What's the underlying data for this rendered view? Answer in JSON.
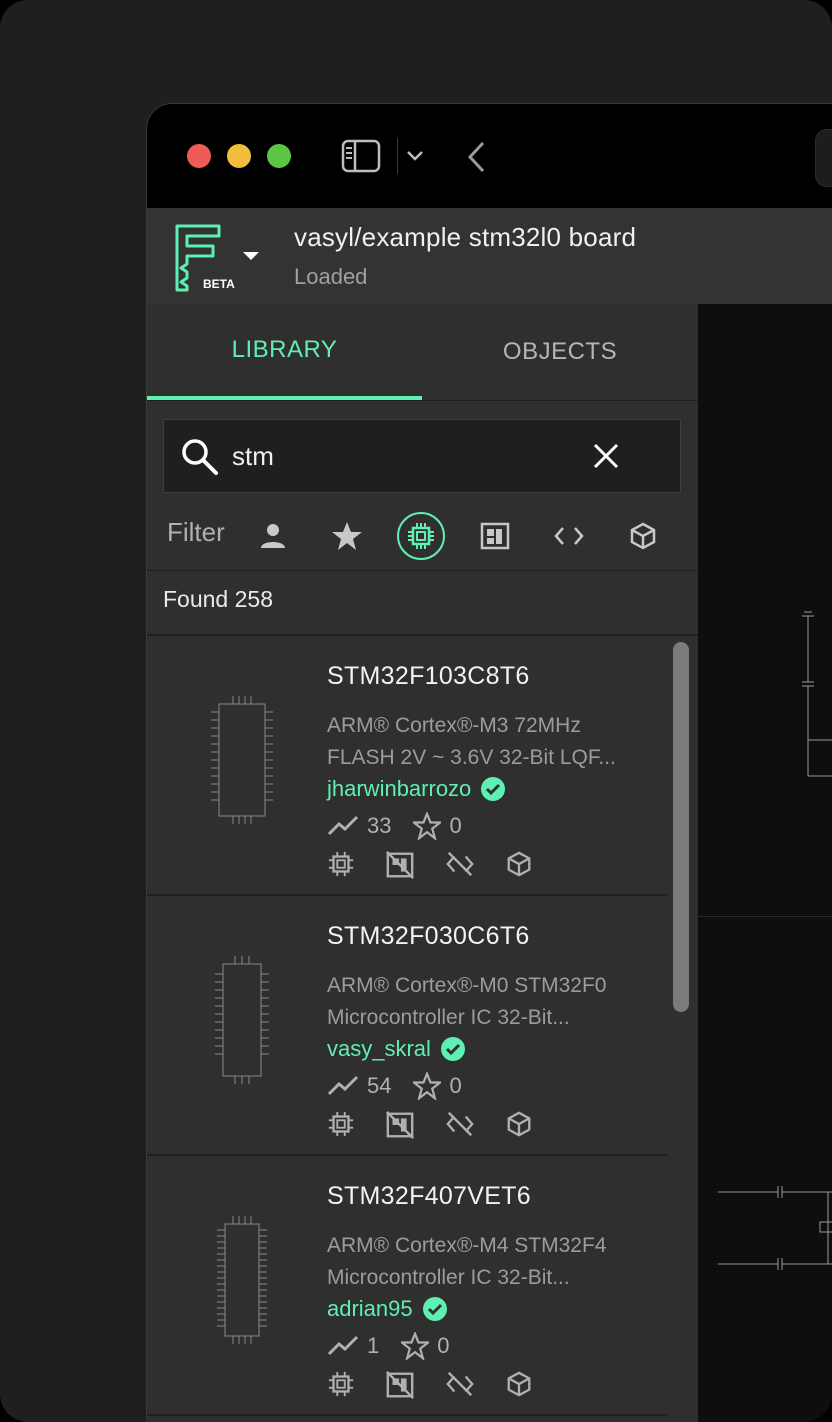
{
  "project": {
    "title": "vasyl/example stm32l0 board",
    "status": "Loaded",
    "logo_badge": "BETA"
  },
  "tabs": [
    {
      "label": "LIBRARY"
    },
    {
      "label": "OBJECTS"
    }
  ],
  "search": {
    "value": "stm"
  },
  "filter": {
    "label": "Filter",
    "icons": [
      "person-icon",
      "star-icon",
      "chip-icon",
      "footprint-icon",
      "code-icon",
      "cube-icon"
    ],
    "active": "chip-icon"
  },
  "results": {
    "found_label": "Found 258",
    "items": [
      {
        "title": "STM32F103C8T6",
        "desc_line1": "ARM® Cortex®-M3 72MHz",
        "desc_line2": "FLASH 2V ~ 3.6V 32-Bit LQF...",
        "author": "jharwinbarrozo",
        "usage": "33",
        "stars": "0"
      },
      {
        "title": "STM32F030C6T6",
        "desc_line1": "ARM® Cortex®-M0 STM32F0",
        "desc_line2": "Microcontroller IC 32-Bit...",
        "author": "vasy_skral",
        "usage": "54",
        "stars": "0"
      },
      {
        "title": "STM32F407VET6",
        "desc_line1": "ARM® Cortex®-M4 STM32F4",
        "desc_line2": "Microcontroller IC 32-Bit...",
        "author": "adrian95",
        "usage": "1",
        "stars": "0"
      }
    ]
  },
  "colors": {
    "accent": "#5ef0b2",
    "panel": "#2f2f2f",
    "header": "#333333"
  }
}
